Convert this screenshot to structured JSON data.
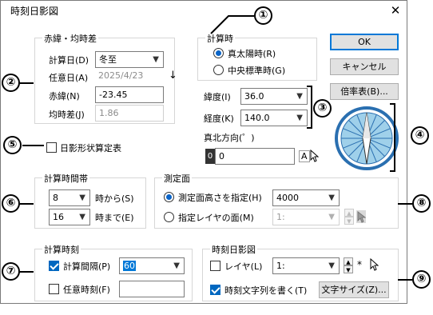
{
  "window": {
    "title": "時刻日影図",
    "close": "✕"
  },
  "declination_group": {
    "title": "赤緯・均時差",
    "calc_day_label": "計算日(D)",
    "calc_day_value": "冬至",
    "arbitrary_day_label": "任意日(A)",
    "arbitrary_day_value": "2025/4/23",
    "down_arrow": "↓",
    "declination_label": "赤緯(N)",
    "declination_value": "-23.45",
    "eq_time_label": "均時差(J)",
    "eq_time_value": "1.86"
  },
  "calc_time_group": {
    "title": "計算時",
    "true_solar_label": "真太陽時(R)",
    "central_std_label": "中央標準時(G)"
  },
  "buttons": {
    "ok": "OK",
    "cancel": "キャンセル",
    "scale": "倍率表(B)...",
    "text_size": "文字サイズ(Z)..."
  },
  "coords": {
    "latitude_label": "緯度(I)",
    "latitude_value": "36.0",
    "longitude_label": "経度(K)",
    "longitude_value": "140.0",
    "north_label": "真北方向(゜)",
    "north_prefix": "0",
    "north_value": "0",
    "north_a": "A"
  },
  "shadow_table": {
    "label": "日影形状算定表"
  },
  "calc_hours_group": {
    "title": "計算時間帯",
    "from_value": "8",
    "from_label": "時から(S)",
    "to_value": "16",
    "to_label": "時まで(E)"
  },
  "plane_group": {
    "title": "測定面",
    "height_label": "測定面高さを指定(H)",
    "height_value": "4000",
    "layer_label": "指定レイヤの面(M)",
    "layer_value": "1:"
  },
  "calc_times_group": {
    "title": "計算時刻",
    "interval_label": "計算間隔(P)",
    "interval_value": "60",
    "arbitrary_label": "任意時刻(F)",
    "arbitrary_value": ""
  },
  "diagram_group": {
    "title": "時刻日影図",
    "layer_label": "レイヤ(L)",
    "layer_value": "1:",
    "star": "*",
    "write_text_label": "時刻文字列を書く(T)"
  },
  "callouts": [
    "①",
    "②",
    "③",
    "④",
    "⑤",
    "⑥",
    "⑦",
    "⑧",
    "⑨"
  ],
  "colors": {
    "accent": "#0078d7",
    "compass_ring": "#2a6fb0",
    "compass_fill": "#9fd0ea"
  }
}
